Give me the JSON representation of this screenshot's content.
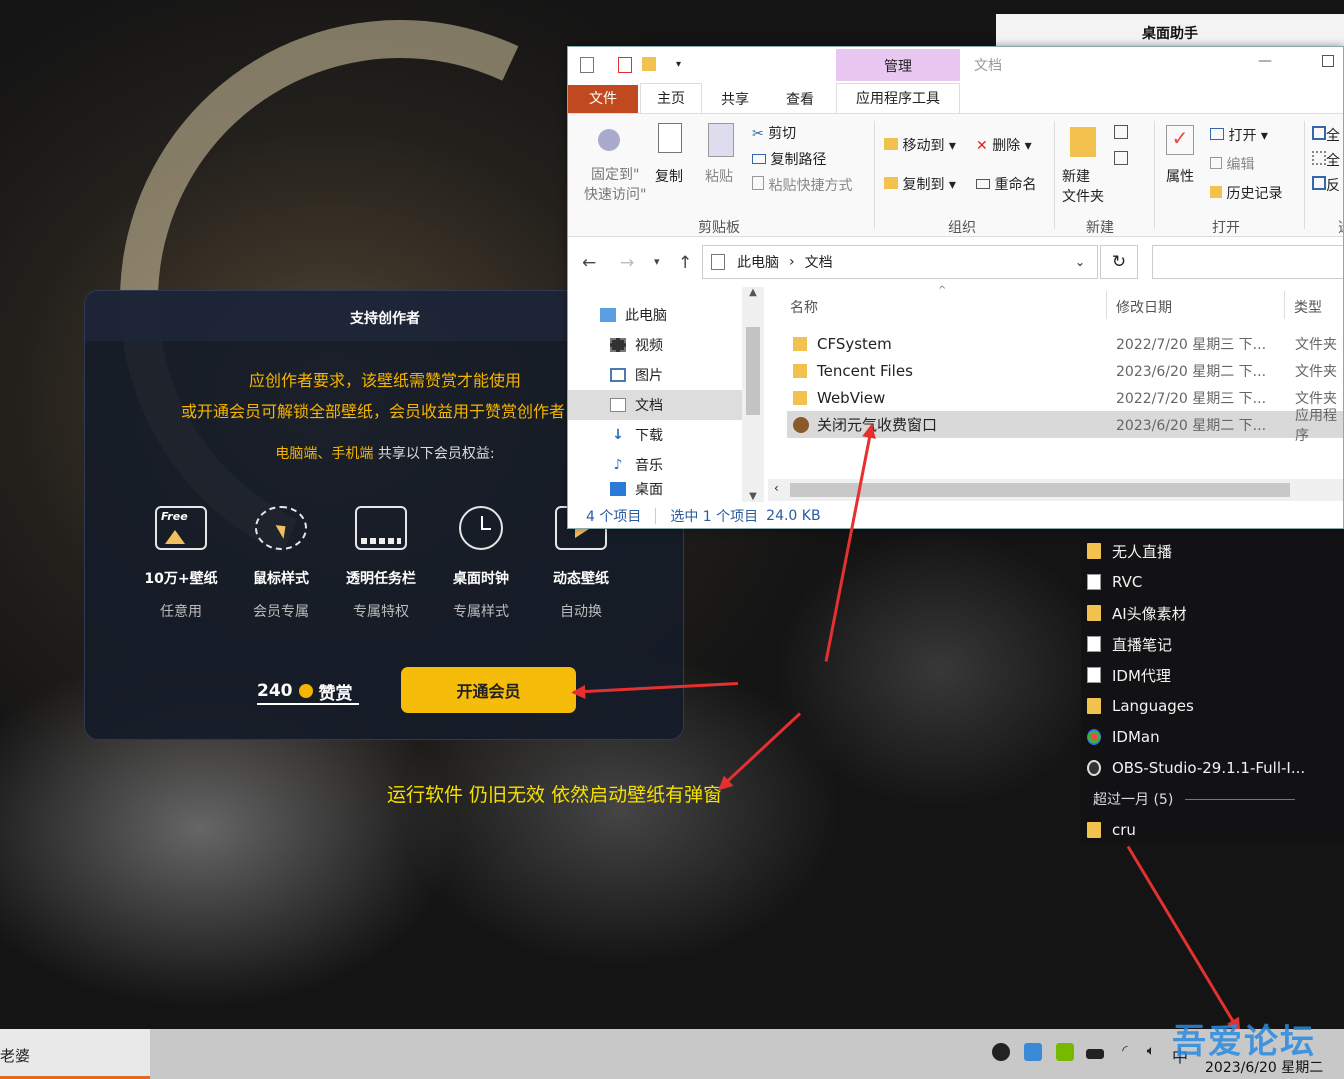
{
  "helper": {
    "title": "桌面助手"
  },
  "modal": {
    "title": "支持创作者",
    "line1": "应创作者要求，该壁纸需赞赏才能使用",
    "line2": "或开通会员可解锁全部壁纸，会员收益用于赞赏创作者",
    "line3_highlight": "电脑端、手机端",
    "line3_rest": " 共享以下会员权益:",
    "features": [
      {
        "name": "10万+壁纸",
        "sub": "任意用",
        "icon": "free-wallpaper-icon",
        "icon_text": "Free"
      },
      {
        "name": "鼠标样式",
        "sub": "会员专属",
        "icon": "cursor-style-icon"
      },
      {
        "name": "透明任务栏",
        "sub": "专属特权",
        "icon": "taskbar-icon"
      },
      {
        "name": "桌面时钟",
        "sub": "专属样式",
        "icon": "clock-icon"
      },
      {
        "name": "动态壁纸",
        "sub": "自动换",
        "icon": "video-wallpaper-icon"
      }
    ],
    "reward_count": "240",
    "reward_label": "赞赏",
    "open_button": "开通会员"
  },
  "annotation": "运行软件 仍旧无效 依然启动壁纸有弹窗",
  "explorer": {
    "title_context_tab": "管理",
    "title": "文档",
    "ribbon_tabs": [
      "文件",
      "主页",
      "共享",
      "查看",
      "应用程序工具"
    ],
    "clipboard": {
      "pin": "固定到\"",
      "pin2": "快速访问\"",
      "copy": "复制",
      "paste": "粘贴",
      "cut": "剪切",
      "copy_path": "复制路径",
      "paste_shortcut": "粘贴快捷方式",
      "group": "剪贴板"
    },
    "organize": {
      "move_to": "移动到",
      "copy_to": "复制到",
      "delete": "删除",
      "rename": "重命名",
      "group": "组织"
    },
    "new": {
      "new_folder": "新建",
      "new_folder2": "文件夹",
      "group": "新建"
    },
    "open": {
      "properties": "属性",
      "open": "打开",
      "edit": "编辑",
      "history": "历史记录",
      "group": "打开"
    },
    "select": {
      "a": "全",
      "b": "全",
      "c": "反",
      "group": "选"
    },
    "address": {
      "root": "此电脑",
      "current": "文档"
    },
    "nav": [
      "此电脑",
      "视频",
      "图片",
      "文档",
      "下载",
      "音乐",
      "桌面"
    ],
    "columns": {
      "name": "名称",
      "date": "修改日期",
      "type": "类型"
    },
    "files": [
      {
        "name": "CFSystem",
        "date": "2022/7/20 星期三 下...",
        "type": "文件夹"
      },
      {
        "name": "Tencent Files",
        "date": "2023/6/20 星期二 下...",
        "type": "文件夹"
      },
      {
        "name": "WebView",
        "date": "2022/7/20 星期三 下...",
        "type": "文件夹"
      },
      {
        "name": "关闭元气收费窗口",
        "date": "2023/6/20 星期二 下...",
        "type": "应用程序"
      }
    ],
    "status": {
      "count": "4 个项目",
      "selected": "选中 1 个项目",
      "size": "24.0 KB"
    }
  },
  "desktop_list": [
    {
      "name": "无人直播",
      "icon": "folder-icon"
    },
    {
      "name": "RVC",
      "icon": "document-icon"
    },
    {
      "name": "AI头像素材",
      "icon": "folder-icon"
    },
    {
      "name": "直播笔记",
      "icon": "document-icon"
    },
    {
      "name": "IDM代理",
      "icon": "document-icon"
    },
    {
      "name": "Languages",
      "icon": "folder-icon"
    },
    {
      "name": "IDMan",
      "icon": "idm-icon"
    },
    {
      "name": "OBS-Studio-29.1.1-Full-I...",
      "icon": "obs-icon"
    }
  ],
  "desktop_group": "超过一月 (5)",
  "desktop_last": "cru",
  "taskbar": {
    "app": "老婆",
    "ime": "中",
    "date": "2023/6/20 星期二"
  },
  "watermark": "吾爱论坛"
}
